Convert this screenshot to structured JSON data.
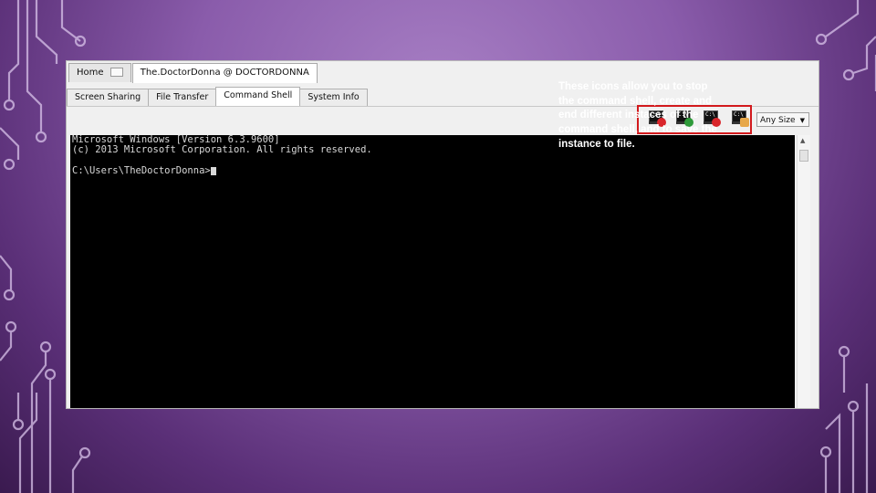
{
  "window": {
    "doc_tabs": [
      {
        "label": "Home",
        "active": false
      },
      {
        "label": "The.DoctorDonna @ DOCTORDONNA",
        "active": true
      }
    ],
    "sub_tabs": [
      {
        "label": "Screen Sharing",
        "active": false
      },
      {
        "label": "File Transfer",
        "active": false
      },
      {
        "label": "Command Shell",
        "active": true
      },
      {
        "label": "System Info",
        "active": false
      }
    ],
    "size_select": {
      "value": "Any Size"
    }
  },
  "toolbar_icons": [
    {
      "name": "stop-shell-icon",
      "badge_color": "#d9262b"
    },
    {
      "name": "new-shell-icon",
      "badge_color": "#2e9a3a"
    },
    {
      "name": "end-shell-icon",
      "badge_color": "#d9262b"
    },
    {
      "name": "save-shell-icon",
      "badge_color": "#e7a84a"
    }
  ],
  "console": {
    "lines": [
      "Microsoft Windows [Version 6.3.9600]",
      "(c) 2013 Microsoft Corporation. All rights reserved.",
      "",
      "C:\\Users\\TheDoctorDonna>"
    ]
  },
  "annotation": {
    "text": "These icons allow you to stop the command shell, create and end different instaces of the command shell, and to save the instance to file."
  },
  "colors": {
    "highlight": "#d2191c",
    "console_bg": "#000000"
  }
}
